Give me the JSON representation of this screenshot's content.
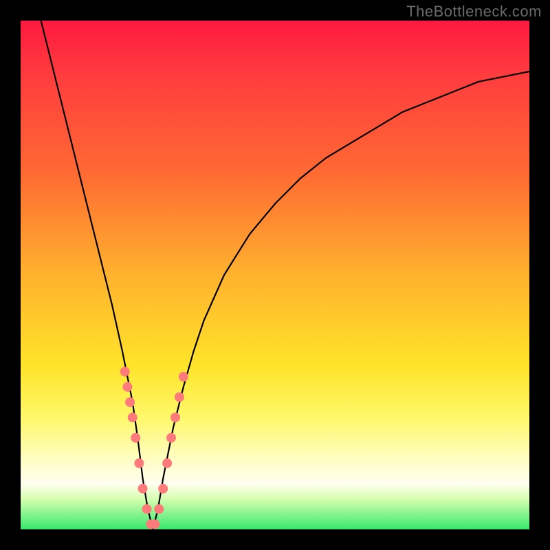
{
  "watermark": "TheBottleneck.com",
  "chart_data": {
    "type": "line",
    "title": "",
    "xlabel": "",
    "ylabel": "",
    "ylim": [
      0,
      100
    ],
    "xlim": [
      0,
      100
    ],
    "series": [
      {
        "name": "bottleneck-curve",
        "x": [
          4,
          6,
          8,
          10,
          12,
          14,
          16,
          18,
          20,
          22,
          23,
          24,
          25,
          26,
          27,
          28,
          30,
          32,
          34,
          36,
          40,
          45,
          50,
          55,
          60,
          65,
          70,
          75,
          80,
          85,
          90,
          95,
          100
        ],
        "y": [
          100,
          92,
          84,
          76,
          68,
          60,
          52,
          44,
          35,
          25,
          18,
          10,
          4,
          0,
          4,
          10,
          20,
          28,
          35,
          41,
          50,
          58,
          64,
          69,
          73,
          76,
          79,
          82,
          84,
          86,
          88,
          89,
          90
        ]
      }
    ],
    "markers": {
      "name": "highlighted-points",
      "x": [
        20.5,
        21.0,
        21.5,
        22.0,
        22.6,
        23.3,
        24.0,
        24.8,
        25.6,
        26.4,
        27.2,
        28.0,
        28.8,
        29.6,
        30.4,
        31.2,
        32.0
      ],
      "y": [
        31,
        28,
        25,
        22,
        18,
        13,
        8,
        4,
        1,
        1,
        4,
        8,
        13,
        18,
        22,
        26,
        30
      ]
    },
    "background_gradient": {
      "top": "#ff1a3f",
      "mid1": "#ff6a33",
      "mid2": "#ffe42a",
      "mid3": "#fffdc0",
      "bottom": "#37e86c"
    }
  }
}
